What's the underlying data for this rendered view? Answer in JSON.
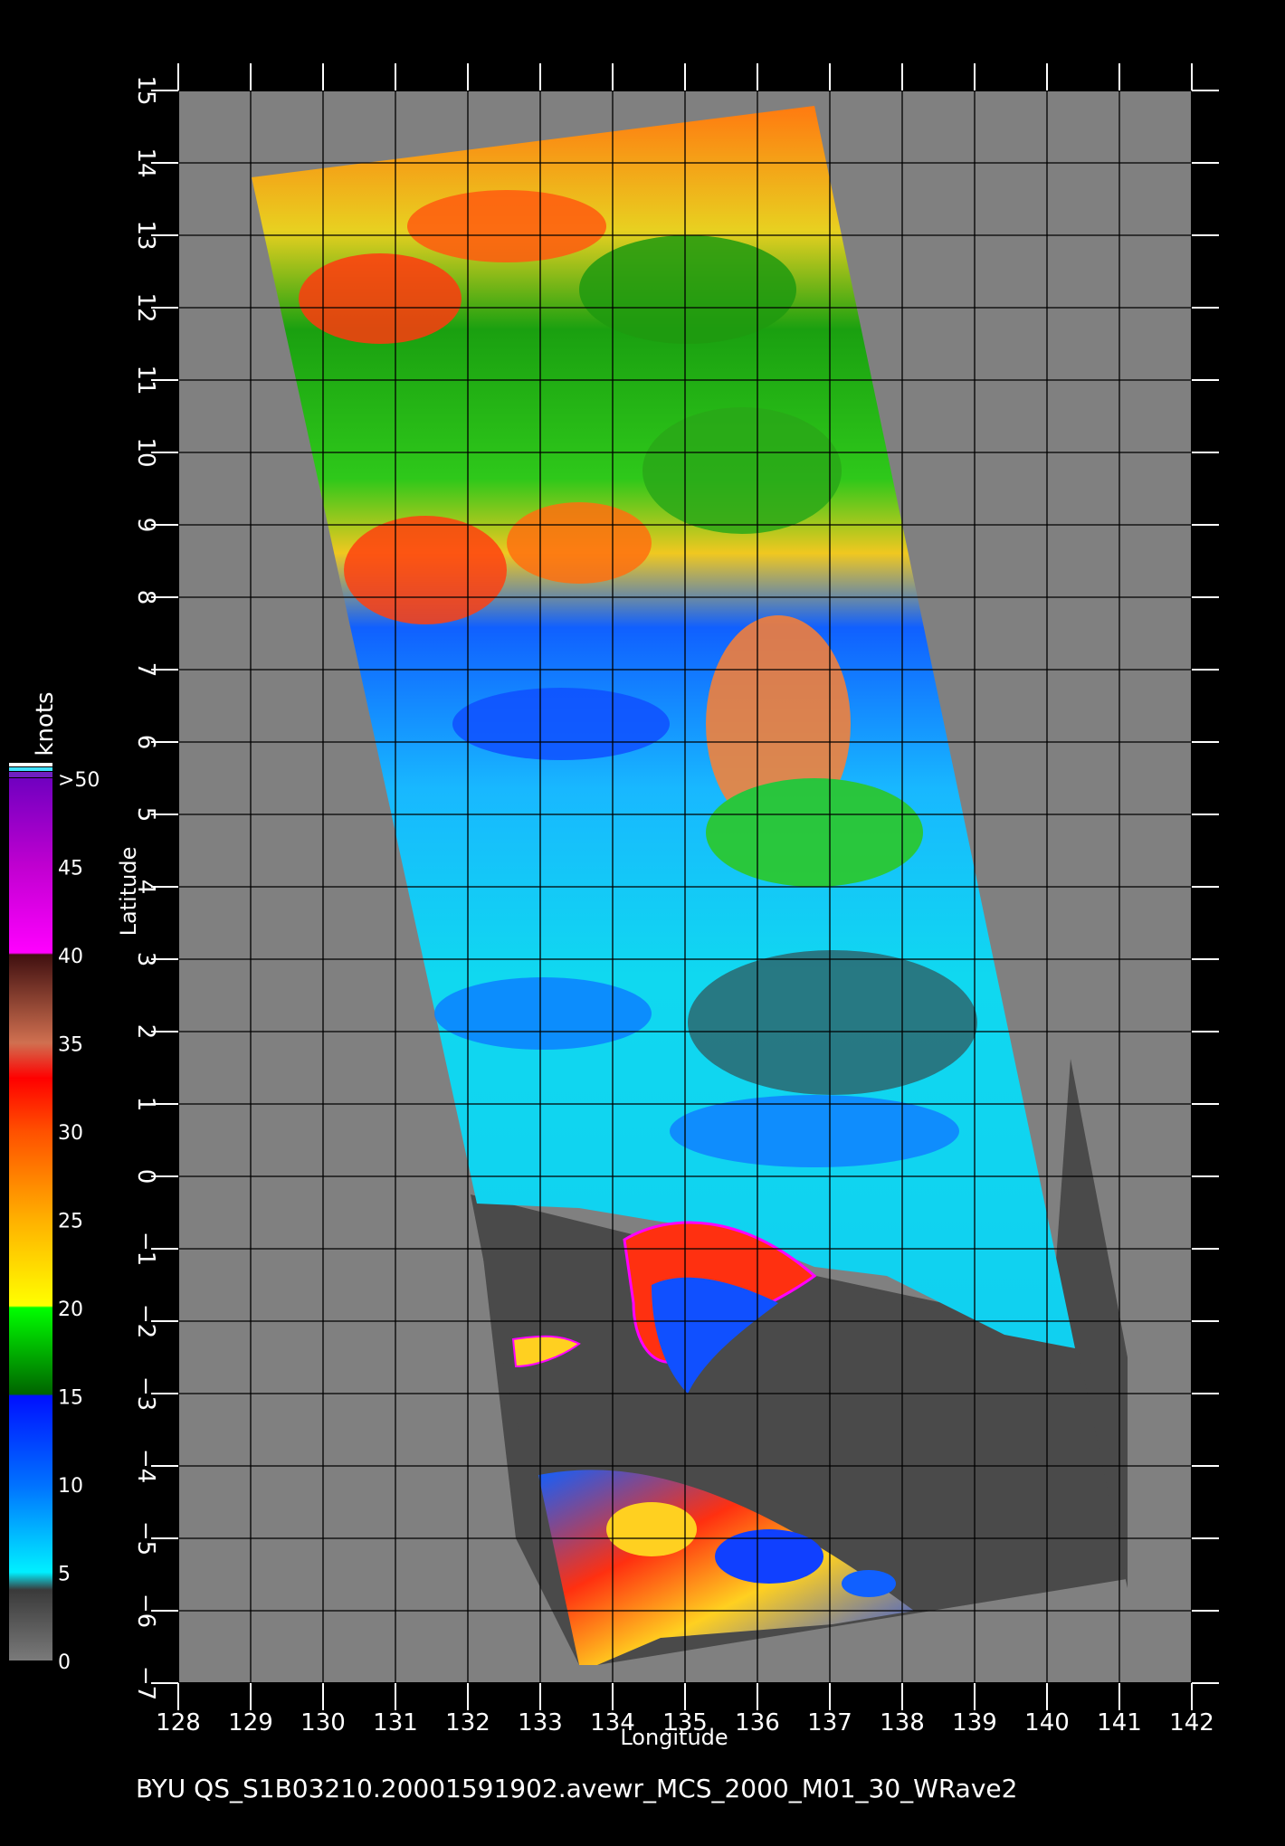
{
  "title_line": "BYU  QS_S1B03210.20001591902.avewr_MCS_2000_M01_30_WRave2",
  "axes": {
    "x_label": "Longitude",
    "y_label": "Latitude",
    "x_range": [
      128,
      142
    ],
    "y_range": [
      -7,
      15
    ],
    "x_ticks": [
      "128",
      "129",
      "130",
      "131",
      "132",
      "133",
      "134",
      "135",
      "136",
      "137",
      "138",
      "139",
      "140",
      "141",
      "142"
    ],
    "y_ticks": [
      "15",
      "14",
      "13",
      "12",
      "11",
      "10",
      "9",
      "8",
      "7",
      "6",
      "5",
      "4",
      "3",
      "2",
      "1",
      "0",
      "−1",
      "−2",
      "−3",
      "−4",
      "−5",
      "−6",
      "−7"
    ],
    "grid": true
  },
  "colorbar": {
    "unit": "knots",
    "tick_labels": [
      ">50",
      "45",
      "40",
      "35",
      "30",
      "25",
      "20",
      "15",
      "10",
      "5",
      "0"
    ],
    "stops": [
      {
        "value": 0,
        "color": "#7a7a7a"
      },
      {
        "value": 4,
        "color": "#3a3a3a"
      },
      {
        "value": 5,
        "color": "#00f0ff"
      },
      {
        "value": 10,
        "color": "#0070ff"
      },
      {
        "value": 15,
        "color": "#0010ff"
      },
      {
        "value": 15.1,
        "color": "#006400"
      },
      {
        "value": 20,
        "color": "#00ff00"
      },
      {
        "value": 20.1,
        "color": "#ffff00"
      },
      {
        "value": 25,
        "color": "#ffb000"
      },
      {
        "value": 30,
        "color": "#ff5000"
      },
      {
        "value": 33,
        "color": "#ff0000"
      },
      {
        "value": 35,
        "color": "#d07050"
      },
      {
        "value": 40,
        "color": "#401010"
      },
      {
        "value": 40.1,
        "color": "#ff00ff"
      },
      {
        "value": 45,
        "color": "#c000d0"
      },
      {
        "value": 50,
        "color": "#7000c0"
      }
    ]
  },
  "colors": {
    "background": "#000000",
    "land_mask": "#808080",
    "no_data_swath": "#4a4a4a",
    "grid": "#000000",
    "text": "#ffffff"
  }
}
